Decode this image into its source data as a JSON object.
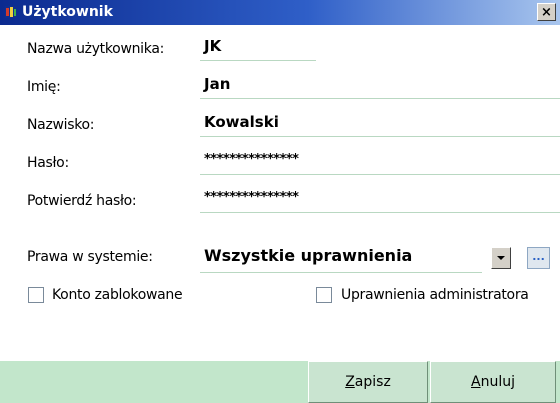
{
  "window": {
    "title": "Użytkownik",
    "close_glyph": "×",
    "app_icon": "app-icon"
  },
  "form": {
    "username": {
      "label": "Nazwa użytkownika:",
      "value": "JK"
    },
    "first_name": {
      "label": "Imię:",
      "value": "Jan"
    },
    "last_name": {
      "label": "Nazwisko:",
      "value": "Kowalski"
    },
    "password": {
      "label": "Hasło:",
      "value": "***************"
    },
    "password_confirm": {
      "label": "Potwierdź hasło:",
      "value": "***************"
    },
    "rights": {
      "label": "Prawa w systemie:",
      "value": "Wszystkie uprawnienia",
      "more_glyph": "..."
    }
  },
  "checkboxes": {
    "account_locked": {
      "label": "Konto zablokowane",
      "checked": false
    },
    "admin_rights": {
      "label": "Uprawnienia administratora",
      "checked": false
    }
  },
  "buttons": {
    "save": {
      "accel": "Z",
      "rest": "apisz"
    },
    "cancel": {
      "accel": "A",
      "rest": "nuluj"
    }
  },
  "colors": {
    "title_gradient_start": "#0b2a8f",
    "footer_bg": "#c2e6cb",
    "field_underline": "#b9d8c2"
  }
}
